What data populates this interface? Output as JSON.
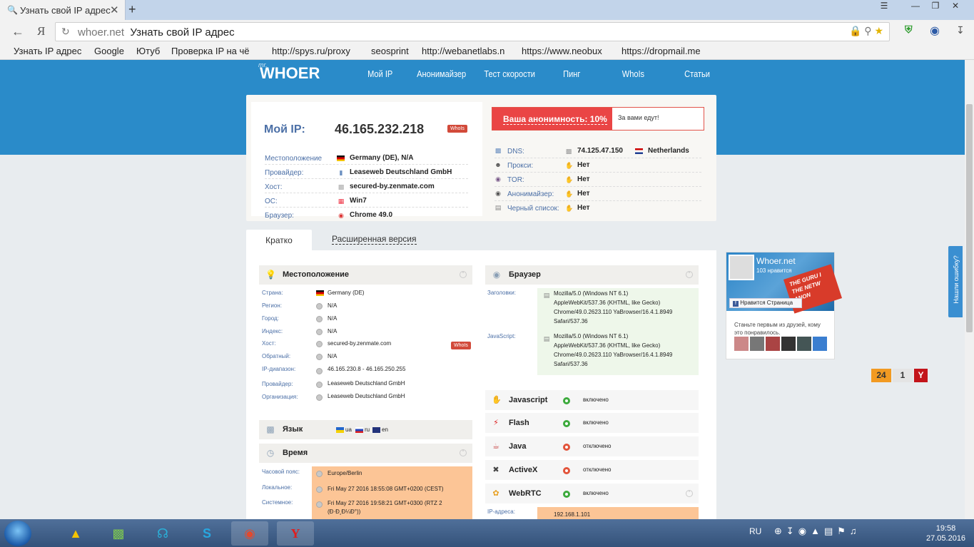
{
  "browser": {
    "tab_title": "Узнать свой IP адрес",
    "url_domain": "whoer.net",
    "url_title": "Узнать свой IP адрес",
    "bookmarks": [
      "Узнать IP адрес",
      "Google",
      "Ютуб",
      "Проверка IP на чё",
      "http://spys.ru/proxy",
      "seosprint",
      "http://webanetlabs.n",
      "https://www.neobux",
      "https://dropmail.me"
    ]
  },
  "site": {
    "logo_mr": "mr.",
    "logo": "WHOER",
    "nav": [
      "Мой IP",
      "Анонимайзер",
      "Тест скорости",
      "Пинг",
      "WhoIs",
      "Статьи"
    ]
  },
  "ipcard": {
    "my_ip_label": "Мой IP:",
    "my_ip": "46.165.232.218",
    "whois_badge": "WhoIs",
    "left_rows": [
      {
        "label": "Местоположение",
        "value": "Germany (DE), N/A"
      },
      {
        "label": "Провайдер:",
        "value": "Leaseweb Deutschland GmbH"
      },
      {
        "label": "Хост:",
        "value": "secured-by.zenmate.com"
      },
      {
        "label": "ОС:",
        "value": "Win7"
      },
      {
        "label": "Браузер:",
        "value": "Chrome 49.0"
      }
    ],
    "anonymity": "Ваша анонимность: 10%",
    "anonymity_note": "За вами едут!",
    "right_rows": [
      {
        "label": "DNS:",
        "value": "74.125.47.150",
        "extra": "Netherlands"
      },
      {
        "label": "Прокси:",
        "value": "Нет"
      },
      {
        "label": "TOR:",
        "value": "Нет"
      },
      {
        "label": "Анонимайзер:",
        "value": "Нет"
      },
      {
        "label": "Черный список:",
        "value": "Нет"
      }
    ]
  },
  "tabs": {
    "short": "Кратко",
    "full": "Расширенная версия"
  },
  "location": {
    "title": "Местоположение",
    "rows": [
      {
        "label": "Страна:",
        "value": "Germany (DE)"
      },
      {
        "label": "Регион:",
        "value": "N/A"
      },
      {
        "label": "Город:",
        "value": "N/A"
      },
      {
        "label": "Индекс:",
        "value": "N/A"
      },
      {
        "label": "Хост:",
        "value": "secured-by.zenmate.com"
      },
      {
        "label": "Обратный:",
        "value": "N/A"
      },
      {
        "label": "IP-диапазон:",
        "value": "46.165.230.8 - 46.165.250.255"
      },
      {
        "label": "Провайдер:",
        "value": "Leaseweb Deutschland GmbH"
      },
      {
        "label": "Организация:",
        "value": "Leaseweb Deutschland GmbH"
      }
    ],
    "whois_badge": "WhoIs"
  },
  "language": {
    "title": "Язык",
    "langs": [
      "ua",
      "ru",
      "en"
    ]
  },
  "time": {
    "title": "Время",
    "rows": [
      {
        "label": "Часовой пояс:",
        "value": "Europe/Berlin"
      },
      {
        "label": "Локальное:",
        "value": "Fri May 27 2016 18:55:08 GMT+0200 (CEST)"
      },
      {
        "label": "Системное:",
        "value": "Fri May 27 2016 19:58:21 GMT+0300 (RTZ 2",
        "value2": "(Ð·Ð¸Ð¼Ð°))"
      }
    ]
  },
  "browser_panel": {
    "title": "Браузер",
    "headers_label": "Заголовки:",
    "headers_ua": [
      "Mozilla/5.0 (Windows NT 6.1)",
      "AppleWebKit/537.36 (KHTML, like Gecko)",
      "Chrome/49.0.2623.110 YaBrowser/16.4.1.8949",
      "Safari/537.36"
    ],
    "js_label": "JavaScript:",
    "js_ua": [
      "Mozilla/5.0 (Windows NT 6.1)",
      "AppleWebKit/537.36 (KHTML, like Gecko)",
      "Chrome/49.0.2623.110 YaBrowser/16.4.1.8949",
      "Safari/537.36"
    ]
  },
  "features": [
    {
      "name": "Javascript",
      "status": "включено",
      "on": true
    },
    {
      "name": "Flash",
      "status": "включено",
      "on": true
    },
    {
      "name": "Java",
      "status": "отключено",
      "on": false
    },
    {
      "name": "ActiveX",
      "status": "отключено",
      "on": false
    },
    {
      "name": "WebRTC",
      "status": "включено",
      "on": true
    }
  ],
  "webrtc": {
    "label": "IP-адреса:",
    "ip": "192.168.1.101"
  },
  "facebook": {
    "name": "Whoer.net",
    "likes": "103 нравится",
    "like_button": "Нравится Страница",
    "banner": "THE GURU I THE NETW ANON",
    "text": "Станьте первым из друзей, кому это понравилось."
  },
  "counters": [
    "24",
    "1"
  ],
  "feedback": "Нашли ошибку?",
  "taskbar": {
    "lang": "RU",
    "time": "19:58",
    "date": "27.05.2016"
  },
  "colors": {
    "hero_blue": "#2a8bc9",
    "alert_red": "#ea4545",
    "on_green": "#3caa3c",
    "off_red": "#e2533a",
    "time_orange": "#fcc596"
  }
}
